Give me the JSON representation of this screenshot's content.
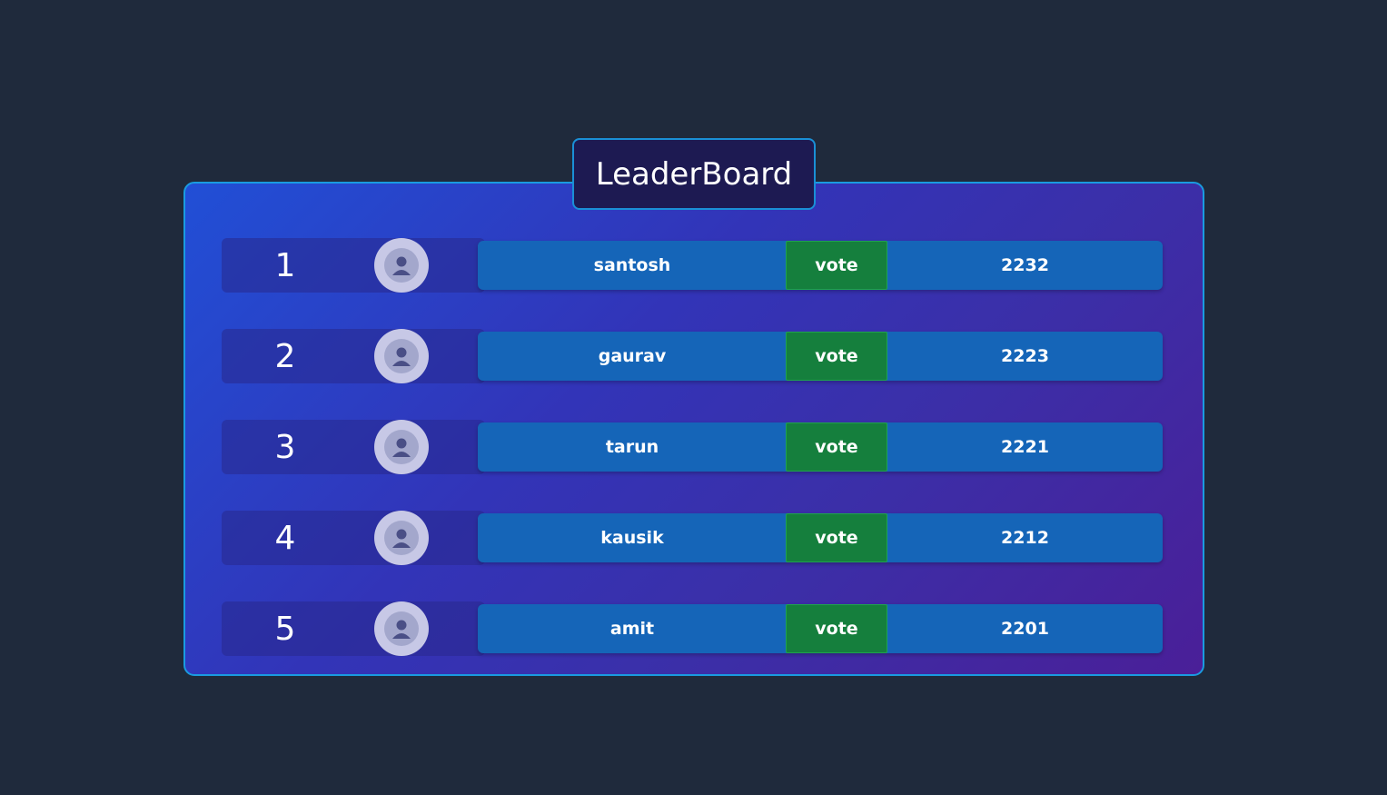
{
  "title": "LeaderBoard",
  "vote_label": "vote",
  "colors": {
    "page_background": "#1f2a3c",
    "board_gradient_start": "#214fd6",
    "board_gradient_end": "#4a1f98",
    "board_border": "#1a9be0",
    "info_bar": "#1565b8",
    "vote_button": "#157f3d",
    "avatar": "#c7c8e6"
  },
  "entries": [
    {
      "rank": "1",
      "name": "santosh",
      "votes": "2232",
      "avatar_icon": "user-avatar-icon"
    },
    {
      "rank": "2",
      "name": "gaurav",
      "votes": "2223",
      "avatar_icon": "user-avatar-icon"
    },
    {
      "rank": "3",
      "name": "tarun",
      "votes": "2221",
      "avatar_icon": "user-avatar-icon"
    },
    {
      "rank": "4",
      "name": "kausik",
      "votes": "2212",
      "avatar_icon": "user-avatar-icon"
    },
    {
      "rank": "5",
      "name": "amit",
      "votes": "2201",
      "avatar_icon": "user-avatar-icon"
    }
  ]
}
